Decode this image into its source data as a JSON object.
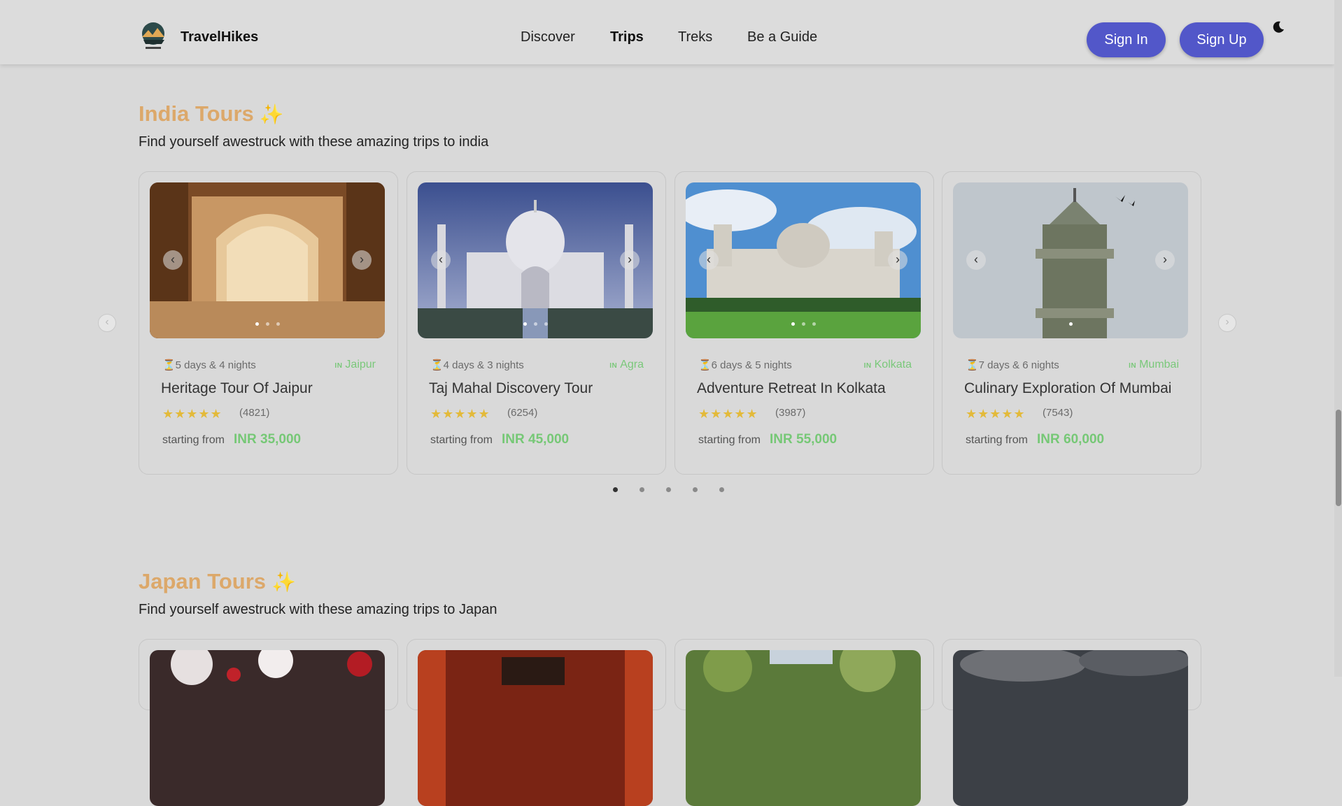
{
  "header": {
    "brand": "TravelHikes",
    "nav": [
      {
        "label": "Discover",
        "active": false
      },
      {
        "label": "Trips",
        "active": true
      },
      {
        "label": "Treks",
        "active": false
      },
      {
        "label": "Be a Guide",
        "active": false
      }
    ],
    "sign_in": "Sign In",
    "sign_up": "Sign Up",
    "theme_icon": "moon-icon"
  },
  "india": {
    "title": "India Tours",
    "title_icon": "sparkles-icon",
    "subtitle": "Find yourself awestruck with these amazing trips to india",
    "cards": [
      {
        "duration": "⏳5 days & 4 nights",
        "location_prefix": "IN",
        "location": "Jaipur",
        "name": "Heritage Tour Of Jaipur",
        "rating_stars": 5,
        "reviews": "(4821)",
        "starting_label": "starting from",
        "price": "INR 35,000"
      },
      {
        "duration": "⏳4 days & 3 nights",
        "location_prefix": "IN",
        "location": "Agra",
        "name": "Taj Mahal Discovery Tour",
        "rating_stars": 5,
        "reviews": "(6254)",
        "starting_label": "starting from",
        "price": "INR 45,000"
      },
      {
        "duration": "⏳6 days & 5 nights",
        "location_prefix": "IN",
        "location": "Kolkata",
        "name": "Adventure Retreat In Kolkata",
        "rating_stars": 5,
        "reviews": "(3987)",
        "starting_label": "starting from",
        "price": "INR 55,000"
      },
      {
        "duration": "⏳7 days & 6 nights",
        "location_prefix": "IN",
        "location": "Mumbai",
        "name": "Culinary Exploration Of Mumbai",
        "rating_stars": 5,
        "reviews": "(7543)",
        "starting_label": "starting from",
        "price": "INR 60,000"
      }
    ],
    "carousel_pages": 5,
    "carousel_active": 1
  },
  "japan": {
    "title": "Japan Tours",
    "title_icon": "sparkles-icon",
    "subtitle": "Find yourself awestruck with these amazing trips to Japan"
  },
  "icons": {
    "prev": "‹",
    "next": "›",
    "star": "★★★★★",
    "sparkle": "✨"
  },
  "colors": {
    "accent_title": "#dca86a",
    "button": "#5257c9",
    "price": "#76c876",
    "star": "#e3ba3a"
  }
}
